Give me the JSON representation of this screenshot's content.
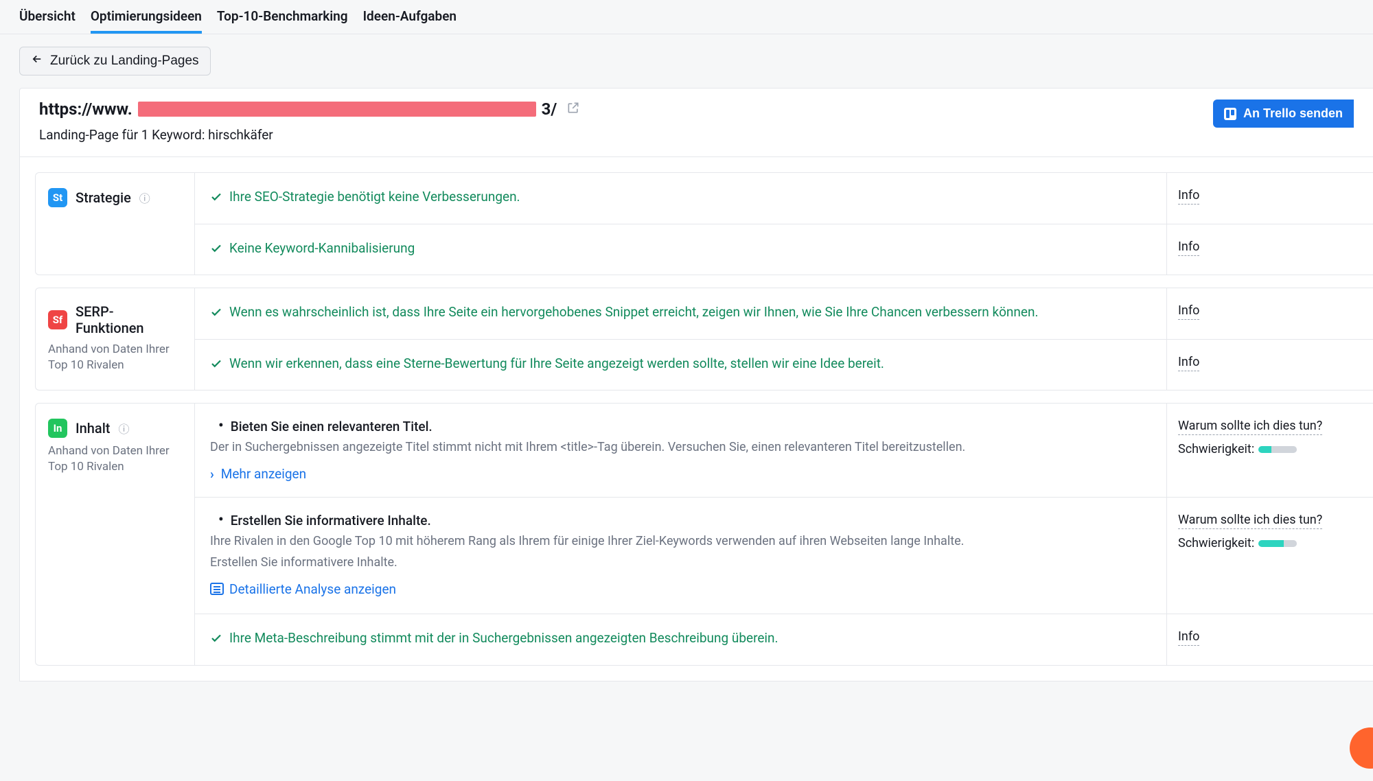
{
  "tabs": {
    "overview": "Übersicht",
    "ideas": "Optimierungsideen",
    "benchmark": "Top-10-Benchmarking",
    "tasks": "Ideen-Aufgaben"
  },
  "back": "Zurück zu Landing-Pages",
  "url_prefix": "https://www.",
  "url_suffix": "3/",
  "subtitle": "Landing-Page für 1 Keyword: hirschkäfer",
  "trello": "An Trello senden",
  "info_label": "Info",
  "why_label": "Warum sollte ich dies tun?",
  "difficulty_label": "Schwierigkeit:",
  "more": "Mehr anzeigen",
  "detailed": "Detaillierte Analyse anzeigen",
  "source_note": "Anhand von Daten Ihrer Top 10 Rivalen",
  "groups": {
    "strategy": {
      "badge": "St",
      "title": "Strategie",
      "items": [
        {
          "ok": true,
          "text": "Ihre SEO-Strategie benötigt keine Verbesserungen.",
          "side": "info"
        },
        {
          "ok": true,
          "text": "Keine Keyword-Kannibalisierung",
          "side": "info"
        }
      ]
    },
    "serp": {
      "badge": "Sf",
      "title": "SERP-Funktionen",
      "items": [
        {
          "ok": true,
          "text": "Wenn es wahrscheinlich ist, dass Ihre Seite ein hervorgehobenes Snippet erreicht, zeigen wir Ihnen, wie Sie Ihre Chancen verbessern können.",
          "side": "info"
        },
        {
          "ok": true,
          "text": "Wenn wir erkennen, dass eine Sterne-Bewertung für Ihre Seite angezeigt werden sollte, stellen wir eine Idee bereit.",
          "side": "info"
        }
      ]
    },
    "content": {
      "badge": "In",
      "title": "Inhalt",
      "items": [
        {
          "ok": false,
          "bullet": "Bieten Sie einen relevanteren Titel.",
          "desc": "Der in Suchergebnissen angezeigte Titel stimmt nicht mit Ihrem <title>-Tag überein. Versuchen Sie, einen relevanteren Titel bereitzustellen.",
          "action": "more",
          "side": "why",
          "difficulty": 1
        },
        {
          "ok": false,
          "bullet": "Erstellen Sie informativere Inhalte.",
          "desc": "Ihre Rivalen in den Google Top 10 mit höherem Rang als Ihrem für einige Ihrer Ziel-Keywords verwenden auf ihren Webseiten lange Inhalte.",
          "desc2": "Erstellen Sie informativere Inhalte.",
          "action": "detailed",
          "side": "why",
          "difficulty": 2
        },
        {
          "ok": true,
          "text": "Ihre Meta-Beschreibung stimmt mit der in Suchergebnissen angezeigten Beschreibung überein.",
          "side": "info"
        }
      ]
    }
  }
}
